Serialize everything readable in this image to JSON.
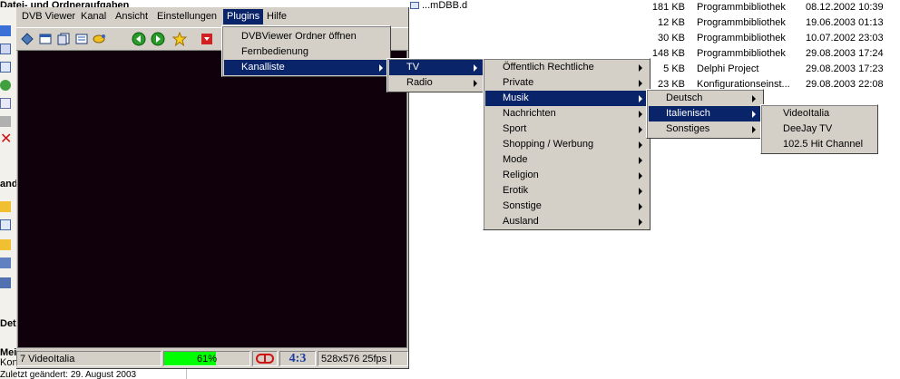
{
  "background": {
    "left_texts": [
      "Datei- und Ordneraufgaben",
      "and",
      "Det",
      "Mei",
      "Konf",
      "Zuletzt geändert: 29. August 2003"
    ],
    "files": [
      {
        "name": "...mDBB.dll",
        "size": "181 KB",
        "type": "Programmbibliothek",
        "date": "08.12.2002 10:39"
      },
      {
        "name": "",
        "size": "12 KB",
        "type": "Programmbibliothek",
        "date": "19.06.2003 01:13"
      },
      {
        "name": "",
        "size": "30 KB",
        "type": "Programmbibliothek",
        "date": "10.07.2002 23:03"
      },
      {
        "name": "",
        "size": "148 KB",
        "type": "Programmbibliothek",
        "date": "29.08.2003 17:24"
      },
      {
        "name": "",
        "size": "5 KB",
        "type": "Delphi Project",
        "date": "29.08.2003 17:23"
      },
      {
        "name": "",
        "size": "23 KB",
        "type": "Konfigurationseinst...",
        "date": "29.08.2003 22:08"
      }
    ]
  },
  "window": {
    "menu": [
      "DVB Viewer",
      "Kanal",
      "Ansicht",
      "Einstellungen",
      "Plugins",
      "Hilfe"
    ],
    "status": {
      "channel": "7 VideoItalia",
      "signal_percent": 61,
      "signal_label": "61%",
      "aspect": "4:3",
      "resolution": "528x576 25fps |"
    },
    "colors": {
      "signal": "#00ff00",
      "record": "#d01010",
      "aspect": "#1a3aa0"
    }
  },
  "menus": {
    "plugins": [
      "DVBViewer Ordner öffnen",
      "Fernbedienung",
      "Kanalliste"
    ],
    "kanalliste": [
      "TV",
      "Radio"
    ],
    "tv": [
      "Öffentlich Rechtliche",
      "Private",
      "Musik",
      "Nachrichten",
      "Sport",
      "Shopping / Werbung",
      "Mode",
      "Religion",
      "Erotik",
      "Sonstige",
      "Ausland"
    ],
    "musik": [
      "Deutsch",
      "Italienisch",
      "Sonstiges"
    ],
    "italienisch": [
      "VideoItalia",
      "DeeJay TV",
      "102.5 Hit Channel"
    ]
  }
}
